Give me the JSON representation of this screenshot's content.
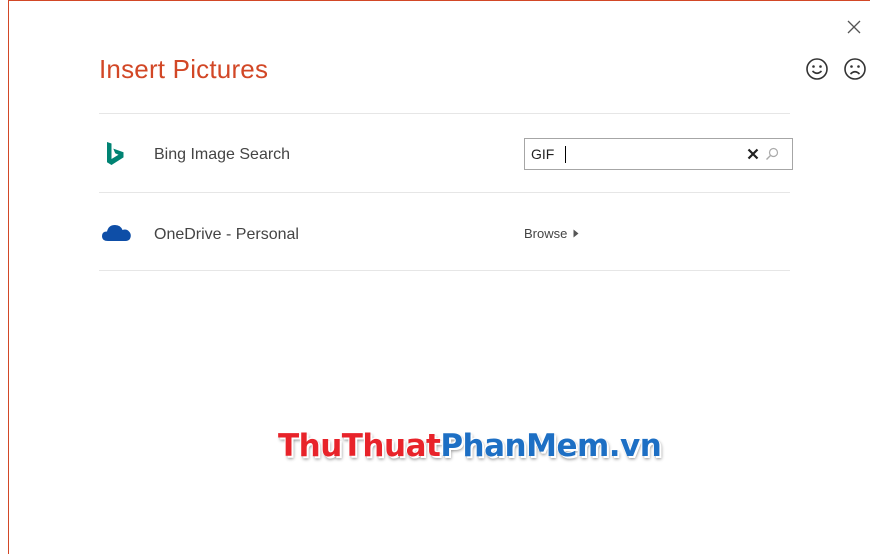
{
  "dialog": {
    "title": "Insert Pictures",
    "accent_color": "#d24726",
    "close_icon": "close-icon",
    "feedback": {
      "smile_icon": "smiley-face-icon",
      "frown_icon": "frowny-face-icon"
    }
  },
  "sources": [
    {
      "icon": "bing-logo-icon",
      "label": "Bing Image Search",
      "search": {
        "value": "GIF",
        "clear_icon": "clear-x-icon",
        "search_icon": "magnifier-icon"
      }
    },
    {
      "icon": "onedrive-cloud-icon",
      "label": "OneDrive - Personal",
      "action_label": "Browse",
      "action_icon": "caret-right-icon"
    }
  ],
  "watermark": {
    "part1": "ThuThuat",
    "part2": "PhanMem",
    "part3": ".vn",
    "color1": "#e8232a",
    "color2": "#1d6fc4"
  }
}
